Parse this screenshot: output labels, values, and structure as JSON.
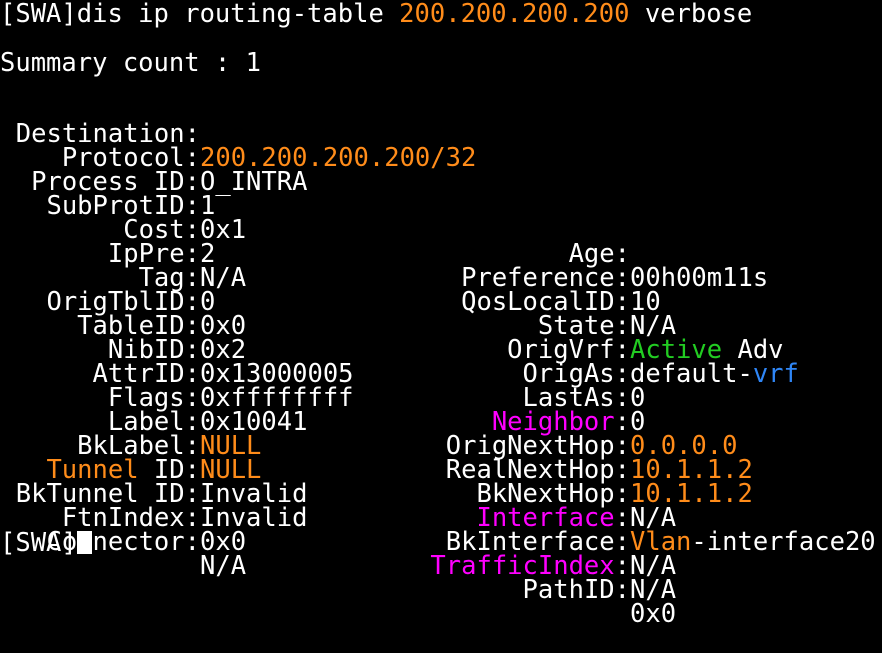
{
  "command": {
    "prompt": "[SWA]",
    "cmd": "dis ip routing-table ",
    "arg": "200.200.200.200",
    "opt": " verbose"
  },
  "summary": "Summary count : 1",
  "destination": {
    "label": "Destination:",
    "value": "200.200.200.200/32"
  },
  "protocol": {
    "label": "Protocol:",
    "value": "O_INTRA"
  },
  "process": {
    "label": "Process ID:",
    "value": "1"
  },
  "rows": [
    {
      "l": "SubProtID:",
      "lv": "0x1",
      "r": "Age:",
      "rv": "00h00m11s"
    },
    {
      "l": "Cost:",
      "lv": "2",
      "r": "Preference:",
      "rv": "10"
    },
    {
      "l": "IpPre:",
      "lv": "N/A",
      "r": "QosLocalID:",
      "rv": "N/A"
    },
    {
      "l": "Tag:",
      "lv": "0",
      "r": "State:",
      "rv_a": "Active",
      "rv_b": " Adv"
    },
    {
      "l": "OrigTblID:",
      "lv": "0x0",
      "r": "OrigVrf:",
      "rv_a": "default-",
      "rv_b": "vrf"
    },
    {
      "l": "TableID:",
      "lv": "0x2",
      "r": "OrigAs:",
      "rv": "0"
    },
    {
      "l": "NibID:",
      "lv": "0x13000005",
      "r": "LastAs:",
      "rv": "0"
    },
    {
      "l": "AttrID:",
      "lv": "0xffffffff",
      "r_a": "Neighbor",
      "r_b": ":",
      "rv": "0.0.0.0"
    },
    {
      "l": "Flags:",
      "lv": "0x10041",
      "r": "OrigNextHop:",
      "rv": "10.1.1.2"
    },
    {
      "l": "Label:",
      "lv": "NULL",
      "r": "RealNextHop:",
      "rv": "10.1.1.2"
    },
    {
      "l": "BkLabel:",
      "lv": "NULL",
      "r": "BkNextHop:",
      "rv": "N/A"
    },
    {
      "l_a": "Tunnel",
      "l_b": " ID:",
      "lv": "Invalid",
      "r_a": "Interface",
      "r_b": ":",
      "rv_a": "Vlan",
      "rv_b": "-interface20"
    },
    {
      "l": "BkTunnel ID:",
      "lv": "Invalid",
      "r": "BkInterface:",
      "rv": "N/A"
    },
    {
      "l": "FtnIndex:",
      "lv": "0x0",
      "r_a": "TrafficIndex",
      "r_b": ":",
      "rv": "N/A"
    },
    {
      "l": "Connector:",
      "lv": "N/A",
      "r": "PathID:",
      "rv": "0x0"
    }
  ],
  "final_prompt": "[SWA]",
  "colors": {
    "background": "#000000",
    "text": "#ffffff",
    "orange": "#ff8c1a",
    "green": "#22cc22",
    "blue": "#2f86f6",
    "magenta": "#ff00ff"
  }
}
